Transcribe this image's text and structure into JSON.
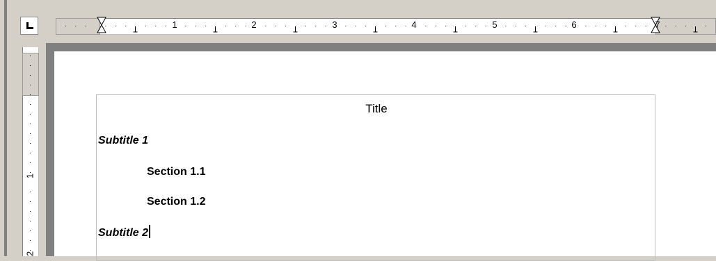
{
  "ruler": {
    "horizontal_numbers": [
      "1",
      "2",
      "3",
      "4",
      "5",
      "6",
      "7"
    ],
    "vertical_numbers": [
      "1",
      "2"
    ]
  },
  "document": {
    "title": "Title",
    "subtitle_1": "Subtitle 1",
    "section_1_1": "Section 1.1",
    "section_1_2": "Section 1.2",
    "subtitle_2": "Subtitle 2"
  },
  "icons": {
    "tab_selector": "left-tab-stop-icon",
    "left_indent": "hourglass-indent-icon",
    "right_indent": "hourglass-indent-icon"
  }
}
